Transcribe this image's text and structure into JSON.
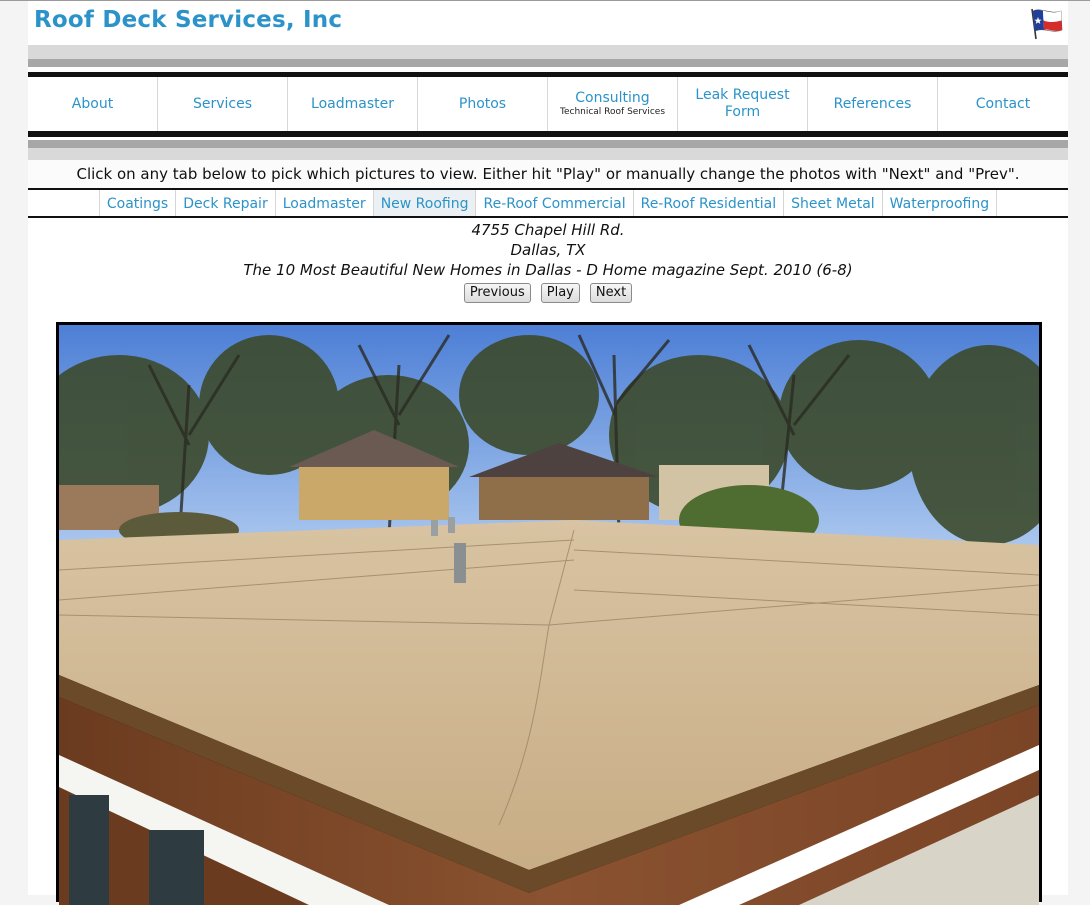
{
  "site": {
    "title": "Roof Deck Services, Inc",
    "flag_icon": "texas-flag-icon"
  },
  "colors": {
    "link": "#2b93c9",
    "active_tab_bg": "#eaf0f3"
  },
  "nav": [
    {
      "label": "About"
    },
    {
      "label": "Services"
    },
    {
      "label": "Loadmaster"
    },
    {
      "label": "Photos"
    },
    {
      "label": "Consulting",
      "sub": "Technical Roof Services"
    },
    {
      "label": "Leak Request Form"
    },
    {
      "label": "References"
    },
    {
      "label": "Contact"
    }
  ],
  "instruction": "Click on any tab below to pick which pictures to view. Either hit \"Play\" or manually change the photos with \"Next\" and \"Prev\".",
  "tabs": [
    {
      "label": "Coatings"
    },
    {
      "label": "Deck Repair"
    },
    {
      "label": "Loadmaster"
    },
    {
      "label": "New Roofing",
      "active": true
    },
    {
      "label": "Re-Roof Commercial"
    },
    {
      "label": "Re-Roof Residential"
    },
    {
      "label": "Sheet Metal"
    },
    {
      "label": "Waterproofing"
    }
  ],
  "photo": {
    "line1": "4755 Chapel Hill Rd.",
    "line2": "Dallas, TX",
    "line3": "The 10 Most Beautiful New Homes in Dallas - D Home magazine Sept. 2010 (6-8)"
  },
  "controls": {
    "previous": "Previous",
    "play": "Play",
    "next": "Next"
  }
}
